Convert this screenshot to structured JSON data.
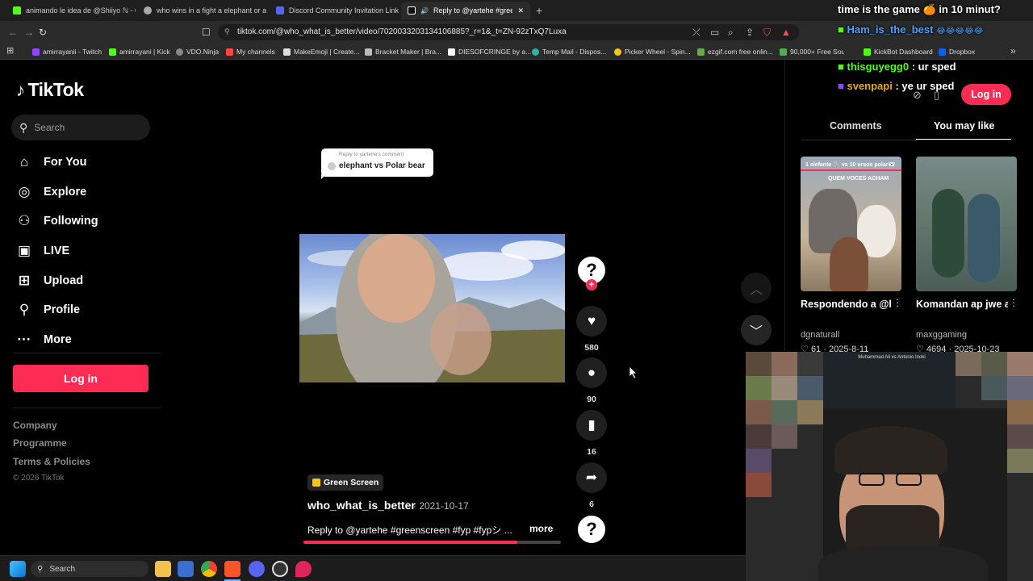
{
  "browser": {
    "tabs": [
      {
        "title": "animando le idea de @Shiiyo ℕ - C..."
      },
      {
        "title": "who wins in a fight a elephant or a g..."
      },
      {
        "title": "Discord Community Invitation Link -"
      },
      {
        "title": "Reply to @yartehe #greensc..."
      }
    ],
    "new_tab": "+",
    "close": "✕",
    "url": "tiktok.com/@who_what_is_better/video/7020033203134106885?_r=1&_t=ZN-92zTxQ7Luxa",
    "bookmarks": [
      {
        "label": "amirrayanii - Twitch",
        "color": "#9146ff"
      },
      {
        "label": "amirrayani | Kick",
        "color": "#53fc18"
      },
      {
        "label": "VDO.Ninja",
        "color": "#888888"
      },
      {
        "label": "My channels",
        "color": "#ff4444"
      },
      {
        "label": "MakeEmoji | Create...",
        "color": "#dddddd"
      },
      {
        "label": "Bracket Maker | Bra...",
        "color": "#bbbbbb"
      },
      {
        "label": "DIESOFCRINGE by a...",
        "color": "#ffffff"
      },
      {
        "label": "Temp Mail - Dispos...",
        "color": "#2bb5a0"
      },
      {
        "label": "Picker Wheel - Spin...",
        "color": "#f5c518"
      },
      {
        "label": "ezgif.com free onlin...",
        "color": "#6aa84f"
      },
      {
        "label": "90,000+ Free Soun...",
        "color": "#55aa55"
      },
      {
        "label": "KickBot Dashboard",
        "color": "#53fc18"
      },
      {
        "label": "Dropbox",
        "color": "#0061fe"
      }
    ]
  },
  "tiktok": {
    "logo": "TikTok",
    "search_placeholder": "Search",
    "nav": [
      {
        "label": "For You",
        "icon": "home-icon"
      },
      {
        "label": "Explore",
        "icon": "compass-icon"
      },
      {
        "label": "Following",
        "icon": "following-icon"
      },
      {
        "label": "LIVE",
        "icon": "live-icon"
      },
      {
        "label": "Upload",
        "icon": "upload-icon"
      },
      {
        "label": "Profile",
        "icon": "profile-icon"
      },
      {
        "label": "More",
        "icon": "more-icon"
      }
    ],
    "login_label": "Log in",
    "footer": [
      "Company",
      "Programme",
      "Terms & Policies",
      "© 2026 TikTok"
    ],
    "reply_card": {
      "header": "Reply to yartehe's comment",
      "text": "elephant vs Polar bear"
    },
    "actions": {
      "likes": "580",
      "comments": "90",
      "saves": "16",
      "shares": "6"
    },
    "tag": "Green Screen",
    "author": "who_what_is_better",
    "date": "· 2021-10-17",
    "caption": "Reply to @yartehe #greenscreen #fyp #fypシ ...",
    "more": "more",
    "progress": 0.83,
    "right": {
      "tab_comments": "Comments",
      "tab_you_may_like": "You may like",
      "cards": [
        {
          "thumb_text": "1 elefante 🐘 vs 10 ursos polar🐻‍❄️",
          "thumb_sub": "QUEM VOCES ACHAM",
          "title": "Respondendo a @bombardirocro...",
          "author": "dgnaturall",
          "likes": "61",
          "date": "· 2025-8-11"
        },
        {
          "thumb_text": "",
          "thumb_sub": "",
          "title": "Komandan ap jwe ak tanperamanm",
          "author": "maxggaming",
          "likes": "4694",
          "date": "· 2025-10-23"
        }
      ]
    }
  },
  "chat": [
    {
      "user": "time is the game",
      "msg": "in 10 minut?",
      "color": "#ffffff",
      "badge": "🍊"
    },
    {
      "user": "Ham_is_the_best",
      "msg": "😂😂😂😂😂",
      "color": "#4aa3ff"
    },
    {
      "user": "thisguyegg0",
      "msg": ": ur sped",
      "color": "#53fc18"
    },
    {
      "user": "svenpapi",
      "msg": ": ye ur sped",
      "color": "#e6a817"
    }
  ],
  "webcam_banner": "Muhammad Ali vs Antonio Inoki",
  "taskbar": {
    "search": "Search"
  }
}
